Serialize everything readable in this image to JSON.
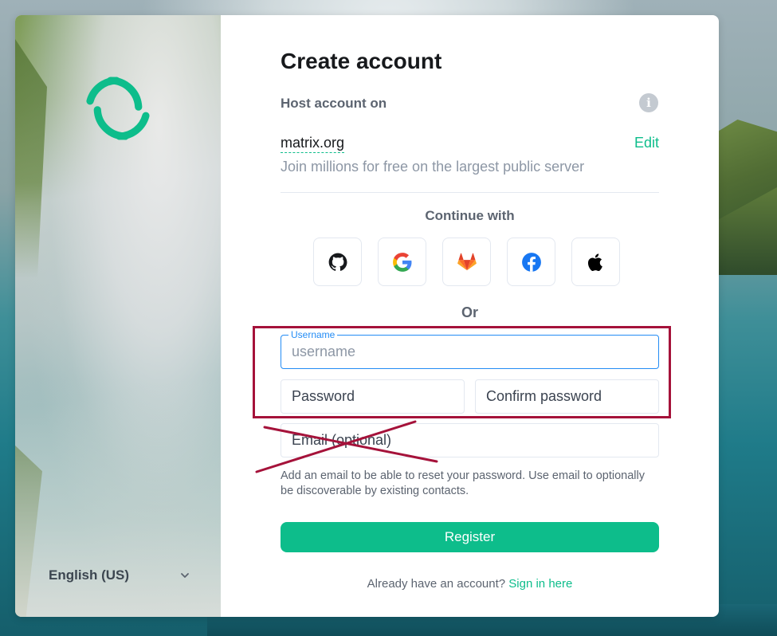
{
  "side": {
    "language": "English (US)"
  },
  "form": {
    "title": "Create account",
    "host_label": "Host account on",
    "server_name": "matrix.org",
    "edit_label": "Edit",
    "server_description": "Join millions for free on the largest public server",
    "continue_with": "Continue with",
    "sso_providers": [
      {
        "name": "GitHub",
        "icon": "github-icon"
      },
      {
        "name": "Google",
        "icon": "google-icon"
      },
      {
        "name": "GitLab",
        "icon": "gitlab-icon"
      },
      {
        "name": "Facebook",
        "icon": "facebook-icon"
      },
      {
        "name": "Apple",
        "icon": "apple-icon"
      }
    ],
    "or_label": "Or",
    "username": {
      "legend": "Username",
      "placeholder": "username",
      "value": ""
    },
    "password": {
      "placeholder": "Password",
      "value": ""
    },
    "confirm_password": {
      "placeholder": "Confirm password",
      "value": ""
    },
    "email": {
      "placeholder": "Email (optional)",
      "value": ""
    },
    "email_help": "Add an email to be able to reset your password. Use email to optionally be discoverable by existing contacts.",
    "register_label": "Register",
    "signin_prompt": "Already have an account?",
    "signin_link": "Sign in here"
  },
  "colors": {
    "accent": "#0dbd8b",
    "focus": "#238cf5",
    "annotation": "#a5123a"
  }
}
